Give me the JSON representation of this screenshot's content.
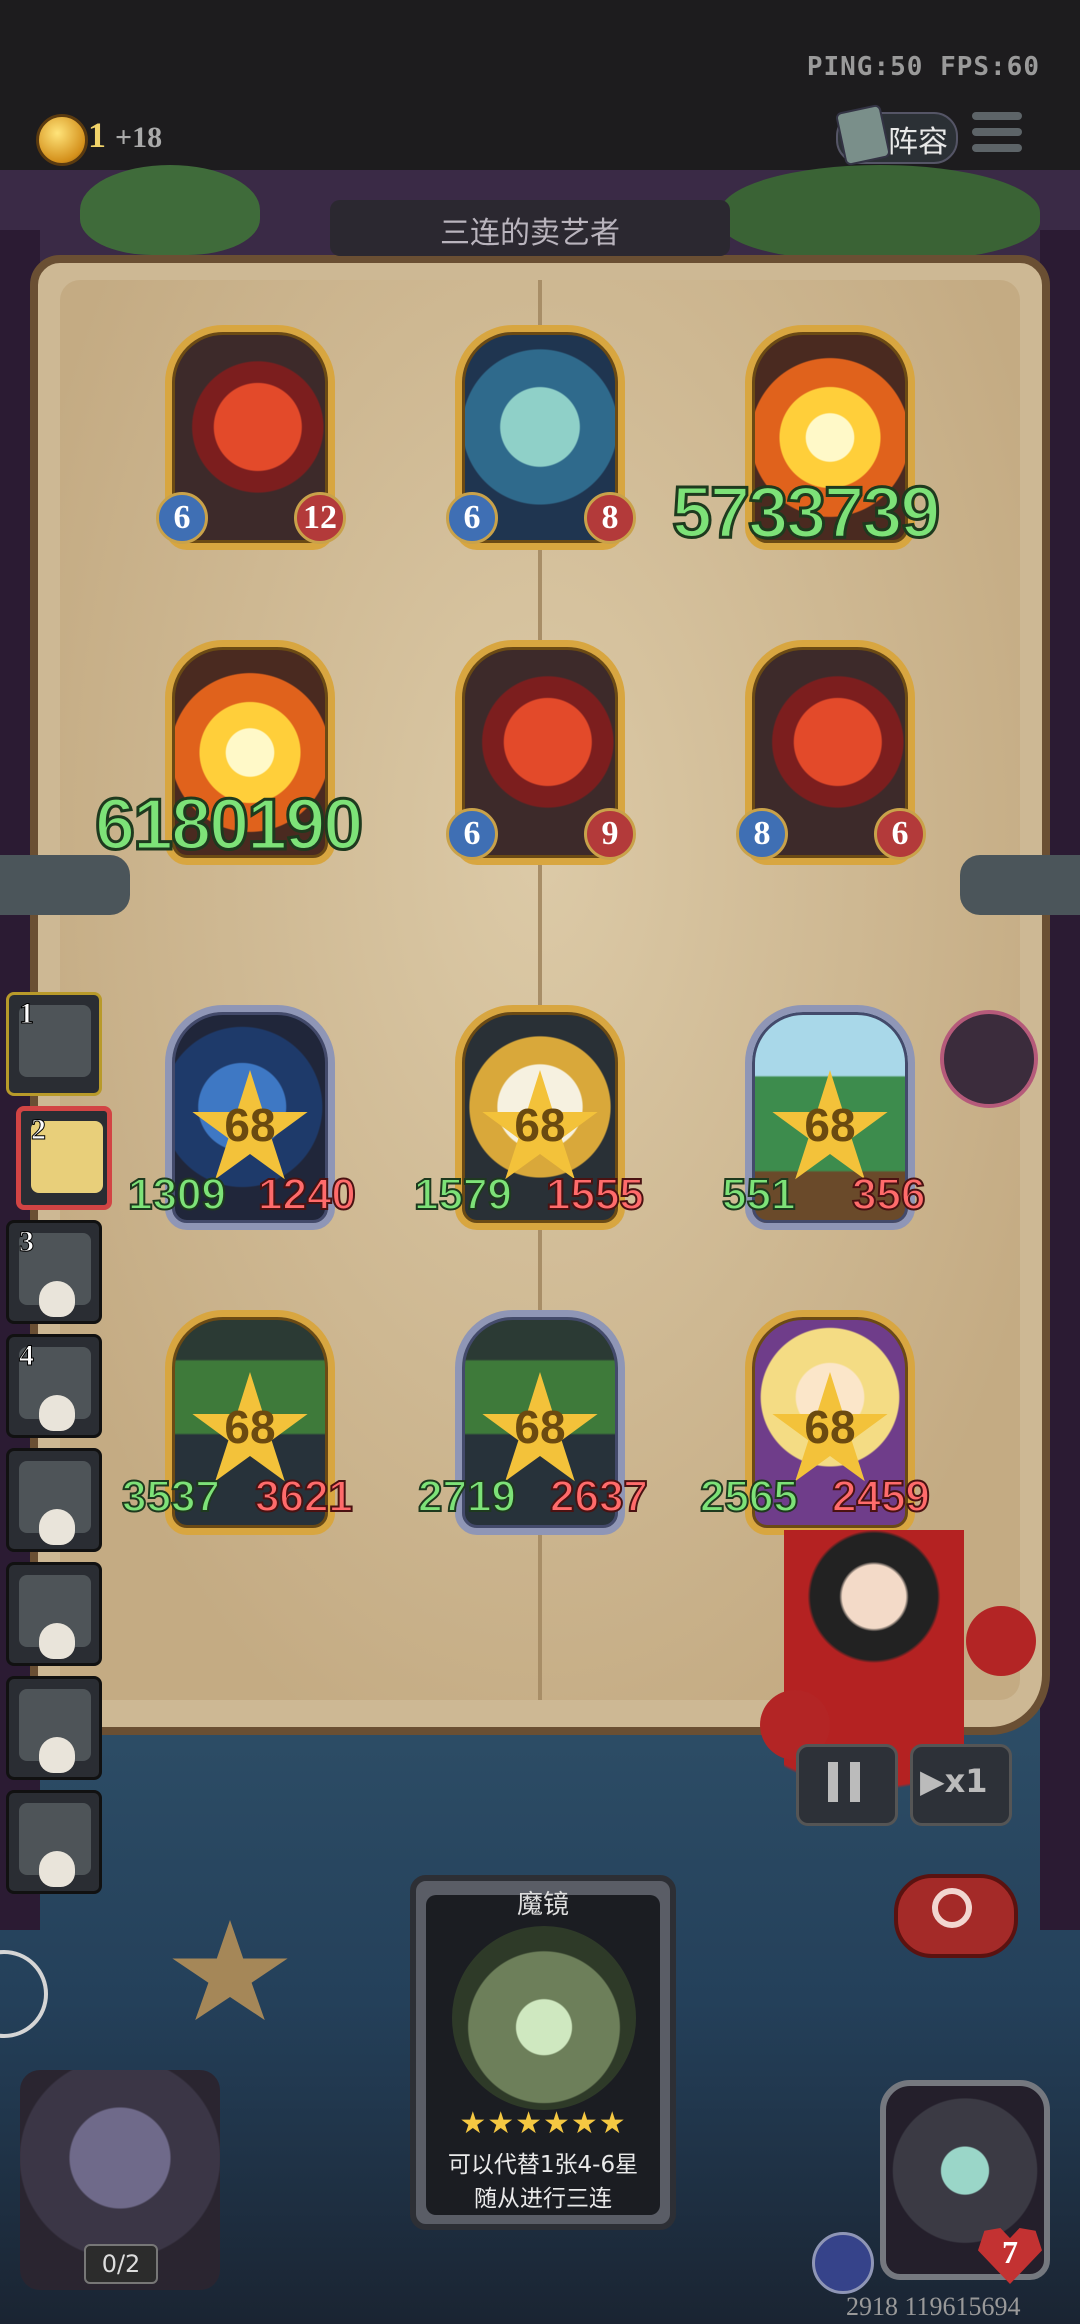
{
  "status": {
    "ping_fps": "PING:50   FPS:60"
  },
  "header": {
    "coins": "1",
    "coins_gain": "+18",
    "lineup_label": "阵容"
  },
  "board": {
    "title": "三连的卖艺者"
  },
  "enemy_cards": [
    {
      "art": "red-dragon",
      "atk": "6",
      "hp": "12"
    },
    {
      "art": "sea-serpent",
      "atk": "6",
      "hp": "8"
    },
    {
      "art": "fire-burst",
      "big_value": "5733739"
    },
    {
      "art": "fire-burst",
      "big_value": "6180190"
    },
    {
      "art": "red-dragon",
      "atk": "6",
      "hp": "9"
    },
    {
      "art": "red-dragon-small",
      "atk": "8",
      "hp": "6"
    }
  ],
  "my_cards": [
    {
      "art": "blue-ghost",
      "star": "68",
      "atk": "1309",
      "hp": "1240"
    },
    {
      "art": "flower-spirit",
      "star": "68",
      "atk": "1579",
      "hp": "1555"
    },
    {
      "art": "tree",
      "star": "68",
      "atk": "551",
      "hp": "356"
    },
    {
      "art": "palm-tree",
      "star": "68",
      "atk": "3537",
      "hp": "3621"
    },
    {
      "art": "palm-tree",
      "star": "68",
      "atk": "2719",
      "hp": "2637"
    },
    {
      "art": "blonde-girl",
      "star": "68",
      "atk": "2565",
      "hp": "2459"
    }
  ],
  "players": [
    {
      "rank": "1",
      "state": "alive"
    },
    {
      "rank": "2",
      "state": "active"
    },
    {
      "rank": "3",
      "state": "dead"
    },
    {
      "rank": "4",
      "state": "dead"
    },
    {
      "rank": "",
      "state": "dead"
    },
    {
      "rank": "",
      "state": "dead"
    },
    {
      "rank": "",
      "state": "dead"
    },
    {
      "rank": "",
      "state": "dead"
    }
  ],
  "controls": {
    "speed_label": "▶x1"
  },
  "item_card": {
    "title": "魔镜",
    "stars": "★★★★★★",
    "desc_line1": "可以代替1张4-6星",
    "desc_line2": "随从进行三连"
  },
  "bench": {
    "count": "0/2"
  },
  "player": {
    "health": "7",
    "uid": "2918 119615694"
  }
}
